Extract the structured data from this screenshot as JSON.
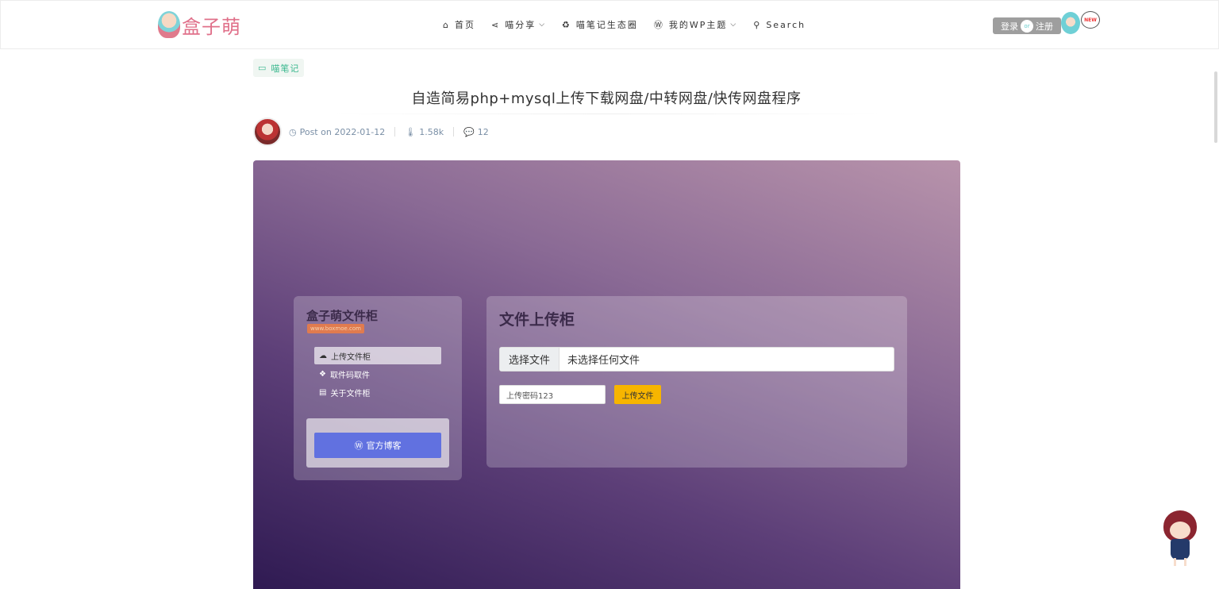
{
  "header": {
    "logo_text": "盒子萌",
    "nav": [
      {
        "icon": "home-icon",
        "glyph": "⌂",
        "label": "首页",
        "dropdown": false
      },
      {
        "icon": "share-icon",
        "glyph": "⋖",
        "label": "喵分享",
        "dropdown": true
      },
      {
        "icon": "recycle-icon",
        "glyph": "♻",
        "label": "喵笔记生态圈",
        "dropdown": false
      },
      {
        "icon": "wordpress-icon",
        "glyph": "Ⓦ",
        "label": "我的WP主题",
        "dropdown": true
      },
      {
        "icon": "search-icon",
        "glyph": "⚲",
        "label": "Search",
        "dropdown": false
      }
    ],
    "login_label": "登录",
    "or_label": "or",
    "register_label": "注册",
    "new_badge": "NEW"
  },
  "article": {
    "category": "喵笔记",
    "title": "自造简易php+mysql上传下载网盘/中转网盘/快传网盘程序",
    "post_date": "Post on 2022-01-12",
    "views": "1.58k",
    "comments": "12"
  },
  "feature_image": {
    "left_panel": {
      "title": "盒子萌文件柜",
      "url": "www.boxmoe.com",
      "menu": [
        {
          "icon": "cloud-upload-icon",
          "glyph": "☁",
          "label": "上传文件柜",
          "active": true
        },
        {
          "icon": "cubes-icon",
          "glyph": "❖",
          "label": "取件码取件",
          "active": false
        },
        {
          "icon": "file-icon",
          "glyph": "▤",
          "label": "关于文件柜",
          "active": false
        }
      ],
      "blog_button": "官方博客"
    },
    "right_panel": {
      "title": "文件上传柜",
      "choose_file": "选择文件",
      "no_file": "未选择任何文件",
      "password_value": "上传密码123",
      "upload_button": "上传文件"
    }
  },
  "colors": {
    "accent_green": "#3bb88f",
    "brand_pink": "#e0708a",
    "upload_yellow": "#f7b500",
    "blog_blue": "#6171e0"
  }
}
